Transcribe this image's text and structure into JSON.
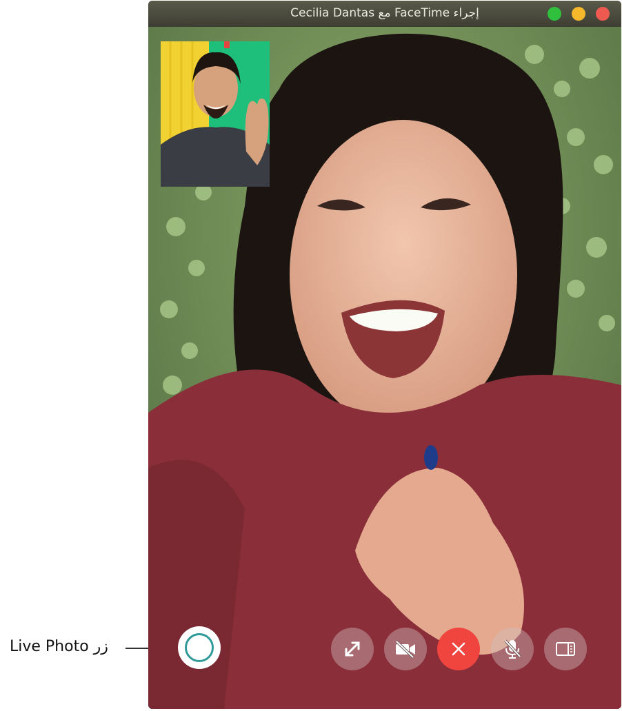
{
  "callout": {
    "label": "زر Live Photo"
  },
  "window": {
    "title": "إجراء FaceTime مع Cecilia Dantas"
  },
  "controls": [
    {
      "name": "fullscreen-button",
      "icon": "expand-arrows-icon"
    },
    {
      "name": "camera-off-button",
      "icon": "video-camera-slash-icon"
    },
    {
      "name": "end-call-button",
      "icon": "close-icon",
      "color": "#f0453f"
    },
    {
      "name": "mute-button",
      "icon": "microphone-slash-icon"
    },
    {
      "name": "sidebar-button",
      "icon": "sidebar-icon"
    }
  ],
  "colors": {
    "end_call": "#f0453f",
    "live_ring": "#2f9a9a"
  }
}
